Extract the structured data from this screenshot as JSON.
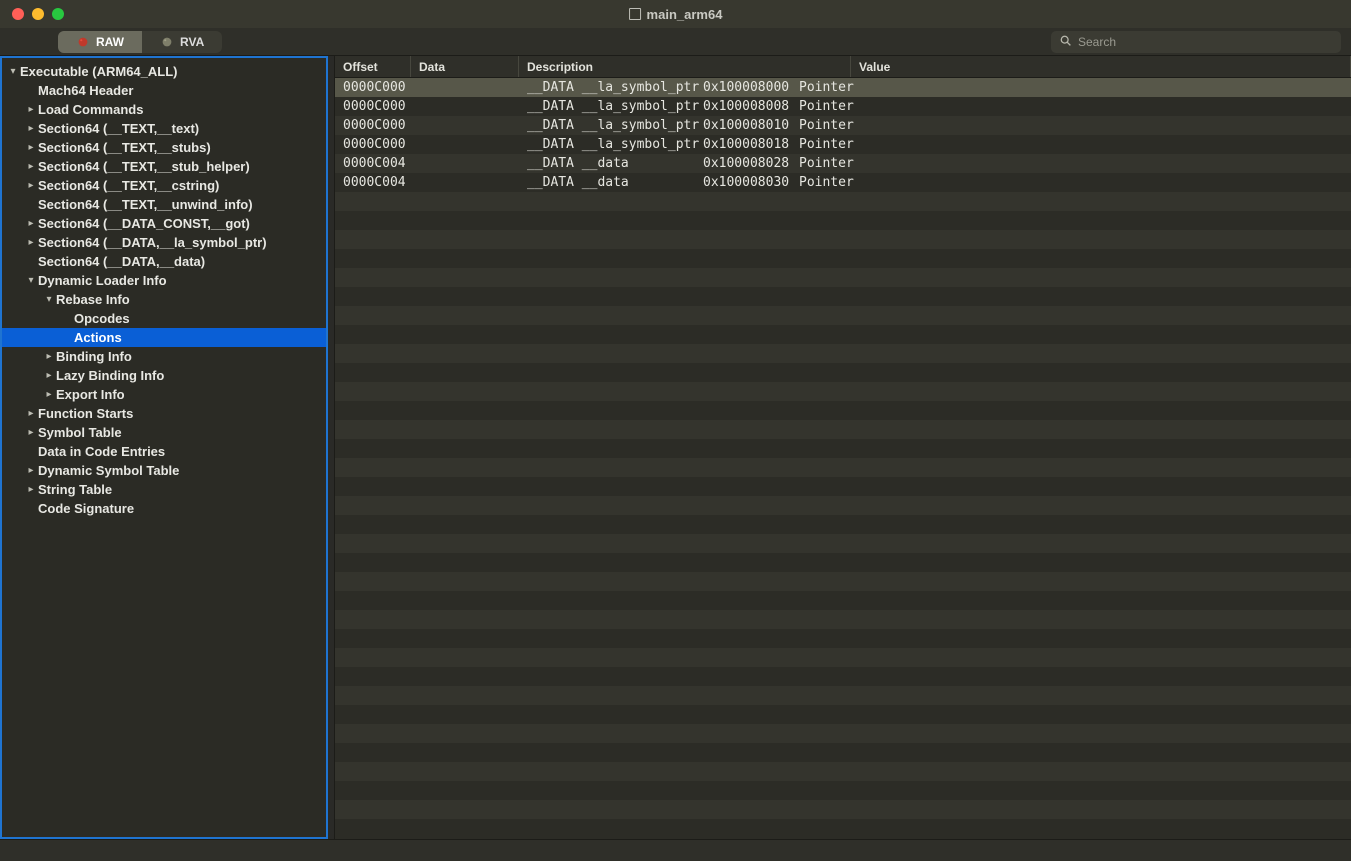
{
  "window": {
    "title": "main_arm64"
  },
  "toolbar": {
    "tabs": {
      "raw": "RAW",
      "rva": "RVA"
    },
    "search_placeholder": "Search"
  },
  "sidebar": {
    "items": [
      {
        "label": "Executable  (ARM64_ALL)",
        "indent": 0,
        "disc": "down",
        "expandable": true
      },
      {
        "label": "Mach64 Header",
        "indent": 1,
        "disc": "none",
        "expandable": false
      },
      {
        "label": "Load Commands",
        "indent": 1,
        "disc": "right",
        "expandable": true
      },
      {
        "label": "Section64 (__TEXT,__text)",
        "indent": 1,
        "disc": "right",
        "expandable": true
      },
      {
        "label": "Section64 (__TEXT,__stubs)",
        "indent": 1,
        "disc": "right",
        "expandable": true
      },
      {
        "label": "Section64 (__TEXT,__stub_helper)",
        "indent": 1,
        "disc": "right",
        "expandable": true
      },
      {
        "label": "Section64 (__TEXT,__cstring)",
        "indent": 1,
        "disc": "right",
        "expandable": true
      },
      {
        "label": "Section64 (__TEXT,__unwind_info)",
        "indent": 1,
        "disc": "none",
        "expandable": false
      },
      {
        "label": "Section64 (__DATA_CONST,__got)",
        "indent": 1,
        "disc": "right",
        "expandable": true
      },
      {
        "label": "Section64 (__DATA,__la_symbol_ptr)",
        "indent": 1,
        "disc": "right",
        "expandable": true
      },
      {
        "label": "Section64 (__DATA,__data)",
        "indent": 1,
        "disc": "none",
        "expandable": false
      },
      {
        "label": "Dynamic Loader Info",
        "indent": 1,
        "disc": "down",
        "expandable": true
      },
      {
        "label": "Rebase Info",
        "indent": 2,
        "disc": "down",
        "expandable": true
      },
      {
        "label": "Opcodes",
        "indent": 3,
        "disc": "none",
        "expandable": false
      },
      {
        "label": "Actions",
        "indent": 3,
        "disc": "none",
        "expandable": false,
        "selected": true
      },
      {
        "label": "Binding Info",
        "indent": 2,
        "disc": "right",
        "expandable": true
      },
      {
        "label": "Lazy Binding Info",
        "indent": 2,
        "disc": "right",
        "expandable": true
      },
      {
        "label": "Export Info",
        "indent": 2,
        "disc": "right",
        "expandable": true
      },
      {
        "label": "Function Starts",
        "indent": 1,
        "disc": "right",
        "expandable": true
      },
      {
        "label": "Symbol Table",
        "indent": 1,
        "disc": "right",
        "expandable": true
      },
      {
        "label": "Data in Code Entries",
        "indent": 1,
        "disc": "none",
        "expandable": false
      },
      {
        "label": "Dynamic Symbol Table",
        "indent": 1,
        "disc": "right",
        "expandable": true
      },
      {
        "label": "String Table",
        "indent": 1,
        "disc": "right",
        "expandable": true
      },
      {
        "label": "Code Signature",
        "indent": 1,
        "disc": "none",
        "expandable": false
      }
    ]
  },
  "table": {
    "columns": [
      "Offset",
      "Data",
      "Description",
      "Value"
    ],
    "rows": [
      {
        "offset": "0000C000",
        "data": "",
        "desc": "__DATA __la_symbol_ptr",
        "addr": "0x100008000",
        "value": "Pointer",
        "selected": true
      },
      {
        "offset": "0000C000",
        "data": "",
        "desc": "__DATA __la_symbol_ptr",
        "addr": "0x100008008",
        "value": "Pointer"
      },
      {
        "offset": "0000C000",
        "data": "",
        "desc": "__DATA __la_symbol_ptr",
        "addr": "0x100008010",
        "value": "Pointer"
      },
      {
        "offset": "0000C000",
        "data": "",
        "desc": "__DATA __la_symbol_ptr",
        "addr": "0x100008018",
        "value": "Pointer"
      },
      {
        "offset": "0000C004",
        "data": "",
        "desc": "__DATA __data",
        "addr": "0x100008028",
        "value": "Pointer"
      },
      {
        "offset": "0000C004",
        "data": "",
        "desc": "__DATA __data",
        "addr": "0x100008030",
        "value": "Pointer"
      }
    ],
    "stripe_total": 40
  }
}
